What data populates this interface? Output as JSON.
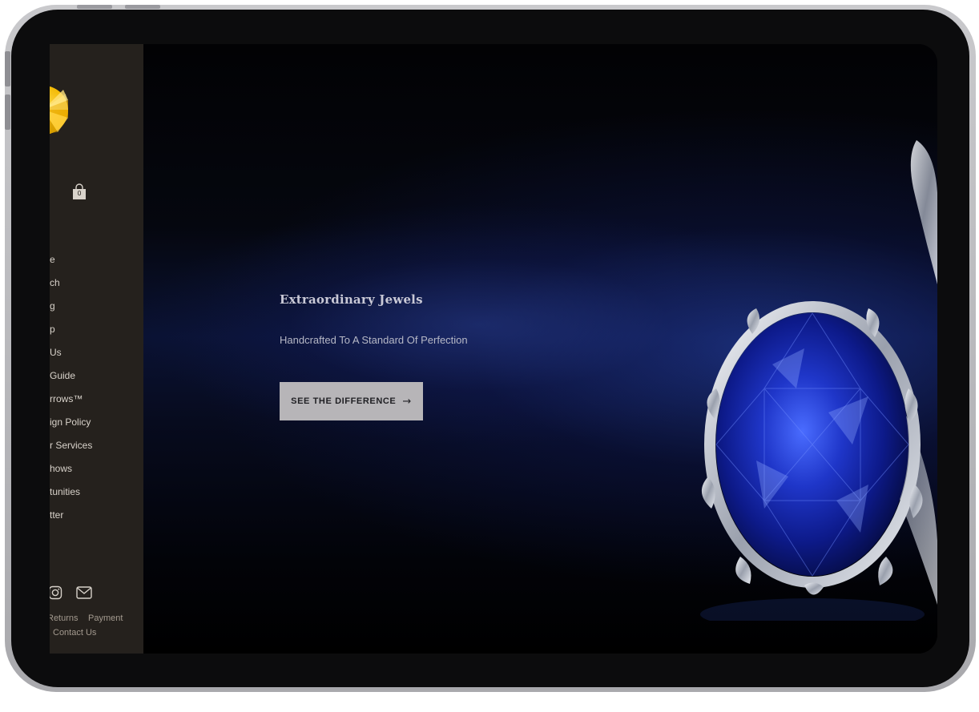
{
  "sidebar": {
    "logo": "sun-logo-icon",
    "cart": {
      "icon": "shopping-bag-icon",
      "count": "0"
    },
    "nav_items": [
      "e",
      "ch",
      "g",
      "p",
      "Us",
      "Guide",
      "rrows™",
      "ign Policy",
      "r Services",
      "hows",
      "tunities",
      "tter"
    ],
    "social": [
      "instagram-icon",
      "mail-icon"
    ],
    "footer_links": {
      "returns": "Returns",
      "payment": "Payment",
      "contact": "Contact Us"
    }
  },
  "hero": {
    "title": "Extraordinary Jewels",
    "subtitle": "Handcrafted To A Standard Of Perfection",
    "cta_label": "SEE THE DIFFERENCE",
    "cta_arrow": "→",
    "image": "sapphire-ring-image"
  },
  "colors": {
    "sidebar_bg": "#25211d",
    "logo_yellow": "#f2b800",
    "hero_blue": "#1a2a7a",
    "button_bg": "#b7b5b8"
  }
}
